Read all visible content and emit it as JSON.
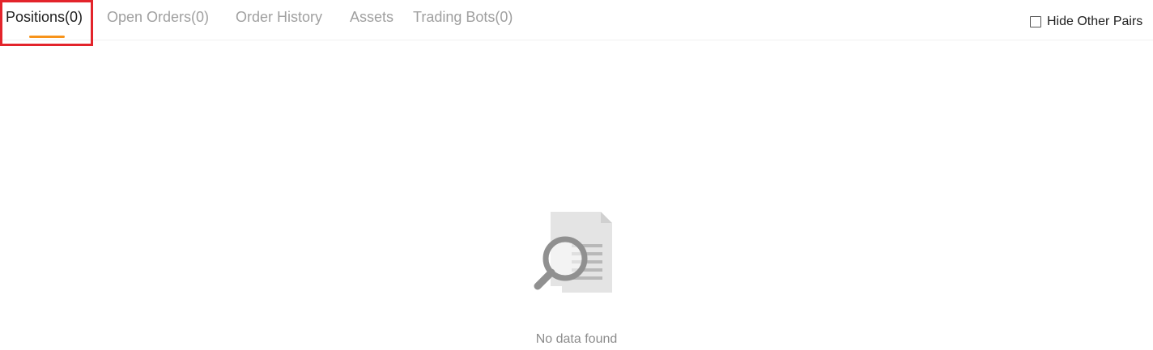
{
  "tabs": [
    {
      "label": "Positions(0)",
      "active": true
    },
    {
      "label": "Open Orders(0)",
      "active": false
    },
    {
      "label": "Order History",
      "active": false
    },
    {
      "label": "Assets",
      "active": false
    },
    {
      "label": "Trading Bots(0)",
      "active": false
    }
  ],
  "filter": {
    "hide_other_pairs_label": "Hide Other Pairs",
    "hide_other_pairs_checked": false
  },
  "empty_state": {
    "icon": "document-search-icon",
    "message": "No data found"
  },
  "colors": {
    "active_tab_text": "#1f1f1f",
    "inactive_tab_text": "#a0a0a0",
    "tab_underline": "#f7931a",
    "highlight_box": "#e3242b",
    "empty_text": "#8c8c8c"
  }
}
